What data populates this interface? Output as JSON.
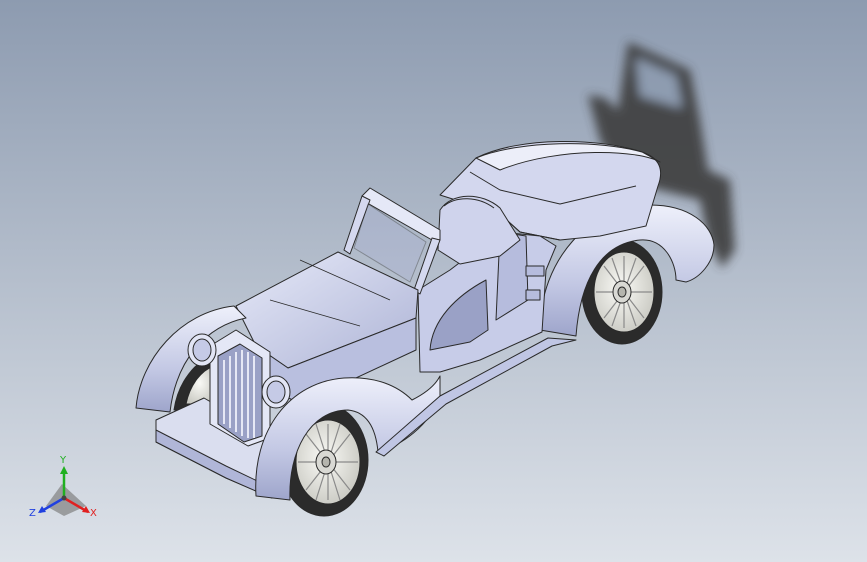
{
  "viewport": {
    "background_top": "#8d9bb0",
    "background_bottom": "#dde2e9",
    "model": "vintage-roadster"
  },
  "view_triad": {
    "x_label": "X",
    "y_label": "Y",
    "z_label": "Z",
    "x_color": "#e02020",
    "y_color": "#20b020",
    "z_color": "#2040e0"
  },
  "colors": {
    "body_light": "#d8dcf0",
    "body_mid": "#bcc2e0",
    "body_dark": "#9aa1c6",
    "edge": "#2a2a2a",
    "tire": "#2b2b2b",
    "rim": "#e4e4e0",
    "shadow": "#3d3d3d"
  }
}
